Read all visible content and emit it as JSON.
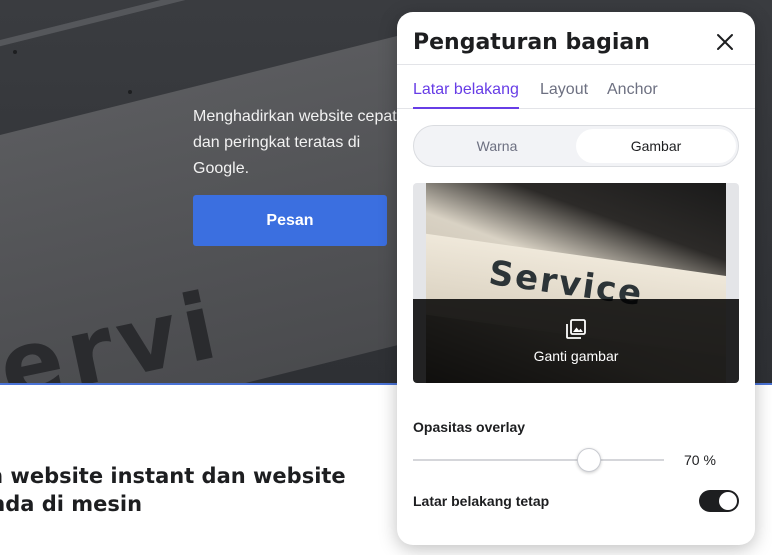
{
  "background_page": {
    "hero_text": "Menghadirkan website cepat dan peringkat teratas di Google.",
    "hero_button_label": "Pesan",
    "section_heading": "an website instant dan website Anda di mesin",
    "hero_letters": "ervi"
  },
  "panel": {
    "title": "Pengaturan bagian",
    "tabs": [
      {
        "label": "Latar belakang",
        "active": true
      },
      {
        "label": "Layout",
        "active": false
      },
      {
        "label": "Anchor",
        "active": false
      }
    ],
    "segmented": {
      "options": [
        "Warna",
        "Gambar"
      ],
      "selected": "Gambar"
    },
    "image": {
      "photo_text": "Service",
      "change_label": "Ganti gambar",
      "change_icon": "image-library-icon"
    },
    "opacity": {
      "label": "Opasitas overlay",
      "value": 70,
      "value_text": "70 %"
    },
    "fixed_background": {
      "label": "Latar belakang tetap",
      "enabled": true
    }
  },
  "colors": {
    "accent": "#673de6",
    "hero_button": "#3b6fe0",
    "toggle_on": "#1d1e20"
  }
}
